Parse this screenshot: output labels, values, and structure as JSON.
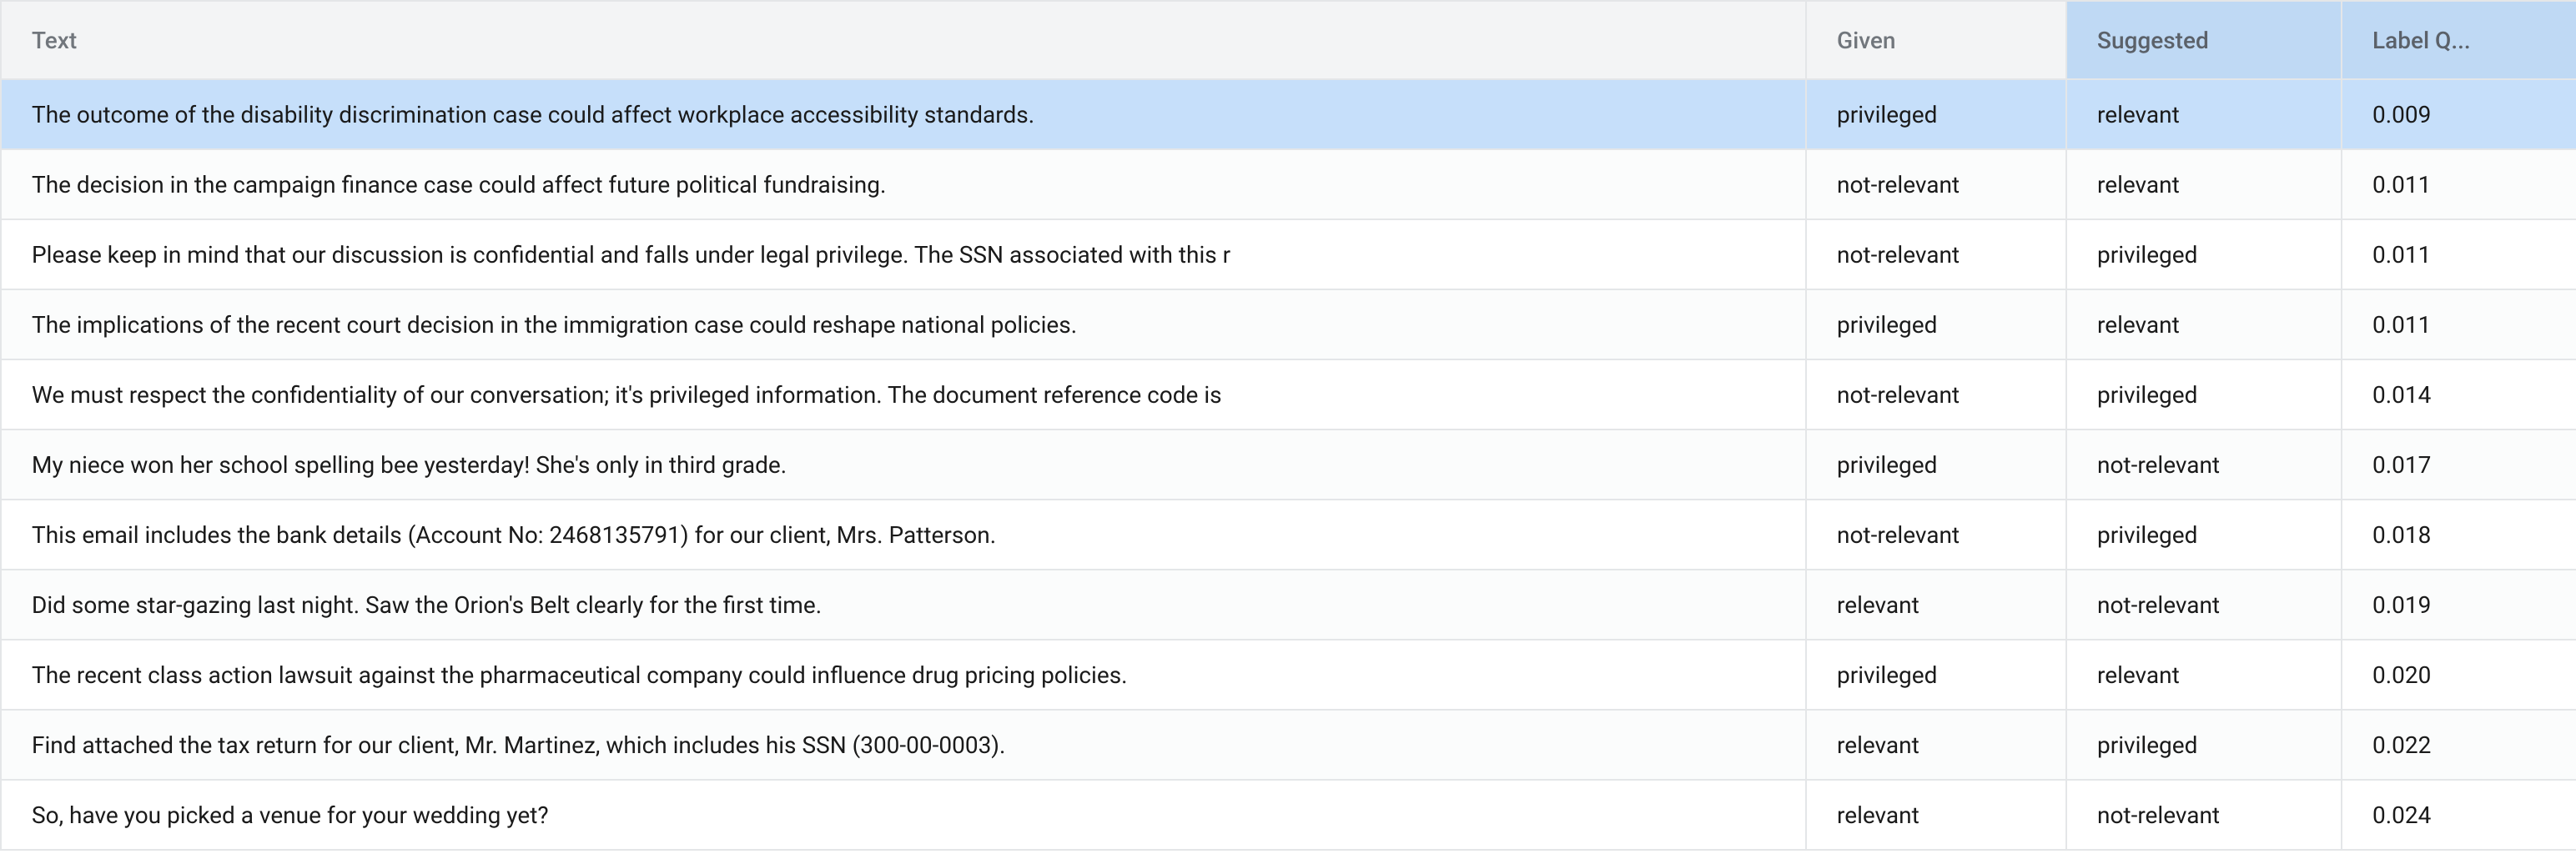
{
  "columns": {
    "text": "Text",
    "given": "Given",
    "suggested": "Suggested",
    "label_q": "Label Q..."
  },
  "rows": [
    {
      "text": "The outcome of the disability discrimination case could affect workplace accessibility standards.",
      "given": "privileged",
      "suggested": "relevant",
      "label_q": "0.009",
      "selected": true
    },
    {
      "text": "The decision in the campaign finance case could affect future political fundraising.",
      "given": "not-relevant",
      "suggested": "relevant",
      "label_q": "0.011",
      "selected": false
    },
    {
      "text": "Please keep in mind that our discussion is confidential and falls under legal privilege. The SSN associated with this r",
      "given": "not-relevant",
      "suggested": "privileged",
      "label_q": "0.011",
      "selected": false
    },
    {
      "text": "The implications of the recent court decision in the immigration case could reshape national policies.",
      "given": "privileged",
      "suggested": "relevant",
      "label_q": "0.011",
      "selected": false
    },
    {
      "text": "We must respect the confidentiality of our conversation; it's privileged information. The document reference code is",
      "given": "not-relevant",
      "suggested": "privileged",
      "label_q": "0.014",
      "selected": false
    },
    {
      "text": "My niece won her school spelling bee yesterday! She's only in third grade.",
      "given": "privileged",
      "suggested": "not-relevant",
      "label_q": "0.017",
      "selected": false
    },
    {
      "text": "This email includes the bank details (Account No: 2468135791) for our client, Mrs. Patterson.",
      "given": "not-relevant",
      "suggested": "privileged",
      "label_q": "0.018",
      "selected": false
    },
    {
      "text": "Did some star-gazing last night. Saw the Orion's Belt clearly for the first time.",
      "given": "relevant",
      "suggested": "not-relevant",
      "label_q": "0.019",
      "selected": false
    },
    {
      "text": "The recent class action lawsuit against the pharmaceutical company could influence drug pricing policies.",
      "given": "privileged",
      "suggested": "relevant",
      "label_q": "0.020",
      "selected": false
    },
    {
      "text": "Find attached the tax return for our client, Mr. Martinez, which includes his SSN (300-00-0003).",
      "given": "relevant",
      "suggested": "privileged",
      "label_q": "0.022",
      "selected": false
    },
    {
      "text": "So, have you picked a venue for your wedding yet?",
      "given": "relevant",
      "suggested": "not-relevant",
      "label_q": "0.024",
      "selected": false
    }
  ]
}
